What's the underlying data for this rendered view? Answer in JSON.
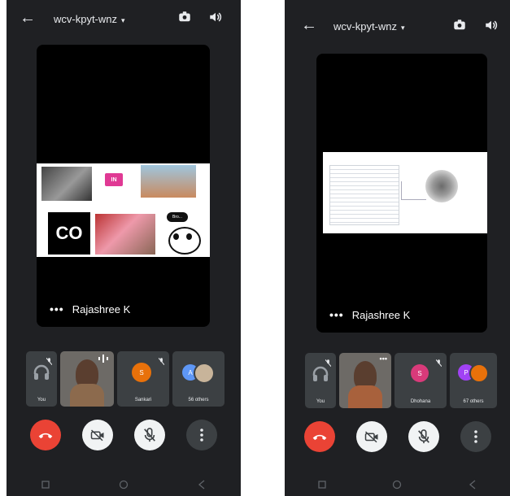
{
  "screens": [
    {
      "meeting_code": "wcv-kpyt-wnz",
      "presenter_name": "Rajashree K",
      "participants": [
        {
          "label": "You"
        },
        {
          "label": ""
        },
        {
          "label": "Sankari",
          "initial": "S"
        },
        {
          "label": "56 others",
          "initial": "A"
        }
      ],
      "shared_tiles": [
        {
          "text": "IN"
        },
        {
          "text": "CO"
        },
        {
          "text": "Bro..."
        }
      ]
    },
    {
      "meeting_code": "wcv-kpyt-wnz",
      "presenter_name": "Rajashree K",
      "participants": [
        {
          "label": "You"
        },
        {
          "label": ""
        },
        {
          "label": "Dhohana",
          "initial": "S"
        },
        {
          "label": "67 others",
          "initial": "P"
        }
      ]
    }
  ],
  "colors": {
    "end_call": "#ea4335",
    "screen_bg": "#1f2023",
    "tile_bg": "#3c4043",
    "sankari_avatar": "#e8710a",
    "others_avatar_left": "#5e97f6",
    "dhohana_avatar": "#d93a7a",
    "others_avatar_right": "#a142f4"
  },
  "icons": [
    "back-arrow-icon",
    "caret-down-icon",
    "switch-camera-icon",
    "speaker-icon",
    "more-dots-icon",
    "mic-off-icon",
    "end-call-icon",
    "camera-off-icon",
    "more-vert-icon",
    "nav-recent-icon",
    "nav-home-icon",
    "nav-back-icon"
  ]
}
